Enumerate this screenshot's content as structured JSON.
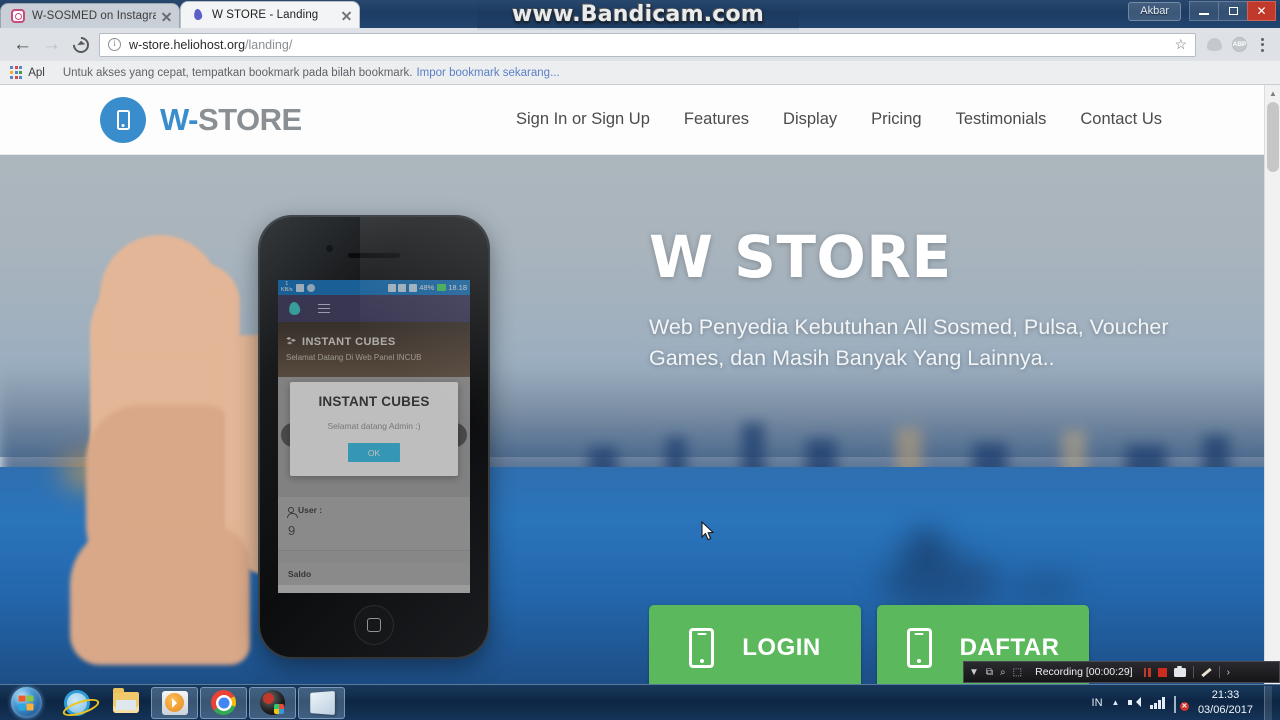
{
  "browser": {
    "tabs": [
      {
        "title": "W-SOSMED on Instagram",
        "favicon": "instagram-icon",
        "active": false
      },
      {
        "title": "W STORE - Landing",
        "favicon": "flame-icon",
        "active": true
      }
    ],
    "window_user": "Akbar",
    "window_controls": {
      "minimize": "minimize-button",
      "maximize": "maximize-button",
      "close": "close-button"
    },
    "nav": {
      "back": "back-arrow",
      "forward": "forward-arrow",
      "reload": "reload-icon"
    },
    "address": {
      "domain": "w-store.heliohost.org",
      "path": "/landing/",
      "security": "info-icon",
      "bookmark": "☆"
    },
    "extensions": [
      "ghostery-icon",
      "abp-icon"
    ],
    "abp_label": "ABP",
    "menu": "chrome-menu-icon",
    "bookmarks_bar": {
      "apps_label": "Apl",
      "hint": "Untuk akses yang cepat, tempatkan bookmark pada bilah bookmark.",
      "link": "Impor bookmark sekarang..."
    }
  },
  "watermark": {
    "text": "www.Bandicam.com"
  },
  "site": {
    "brand": {
      "prefix": "W-",
      "suffix": "STORE",
      "icon": "phone-icon",
      "color_primary": "#3a8dcc",
      "color_secondary": "#8a8f94"
    },
    "nav_items": [
      {
        "label": "Sign In or Sign Up"
      },
      {
        "label": "Features"
      },
      {
        "label": "Display"
      },
      {
        "label": "Pricing"
      },
      {
        "label": "Testimonials"
      },
      {
        "label": "Contact Us"
      }
    ],
    "hero": {
      "title": "W STORE",
      "subtitle": "Web Penyedia Kebutuhan All Sosmed, Pulsa, Voucher Games, dan Masih Banyak Yang Lainnya..",
      "buttons": [
        {
          "label": "LOGIN",
          "icon": "phone-icon",
          "color": "#5cb85c"
        },
        {
          "label": "DAFTAR",
          "icon": "phone-icon",
          "color": "#5cb85c"
        }
      ]
    }
  },
  "phone_mockup": {
    "statusbar": {
      "speed": "1",
      "speed_unit": "KB/s",
      "battery": "48%",
      "time": "18.18"
    },
    "appbar": {
      "logo": "flame-icon",
      "menu": "hamburger-icon"
    },
    "panel": {
      "title": "INSTANT CUBES",
      "icon": "cubes-icon",
      "subtitle": "Selamat Datang Di Web Panel INCUB"
    },
    "dialog": {
      "title": "INSTANT CUBES",
      "message": "Selamat datang Admin :)",
      "ok_label": "OK",
      "prev_arrow": "«",
      "next_arrow": "»"
    },
    "stats": [
      {
        "label": "User :",
        "value": "9",
        "icon": "user-icon"
      },
      {
        "label": "Saldo",
        "value": "",
        "icon": "wallet-icon"
      }
    ]
  },
  "recorder": {
    "status": "Recording [00:00:29]",
    "controls": [
      "dropdown-icon",
      "window-icon",
      "magnifier-icon",
      "region-icon",
      "pause-icon",
      "stop-icon",
      "screenshot-icon",
      "pencil-icon",
      "expand-icon"
    ]
  },
  "taskbar": {
    "start": "start-orb",
    "items": [
      {
        "name": "internet-explorer",
        "open": false
      },
      {
        "name": "file-explorer",
        "open": false
      },
      {
        "name": "windows-media-player",
        "open": true
      },
      {
        "name": "google-chrome",
        "open": true
      },
      {
        "name": "bandicam",
        "open": true
      },
      {
        "name": "sticky-notes",
        "open": true
      }
    ],
    "tray": {
      "language": "IN",
      "icons": [
        "show-hidden-icon",
        "volume-icon",
        "network-signal-icon",
        "action-center-icon"
      ],
      "time": "21:33",
      "date": "03/06/2017"
    }
  }
}
